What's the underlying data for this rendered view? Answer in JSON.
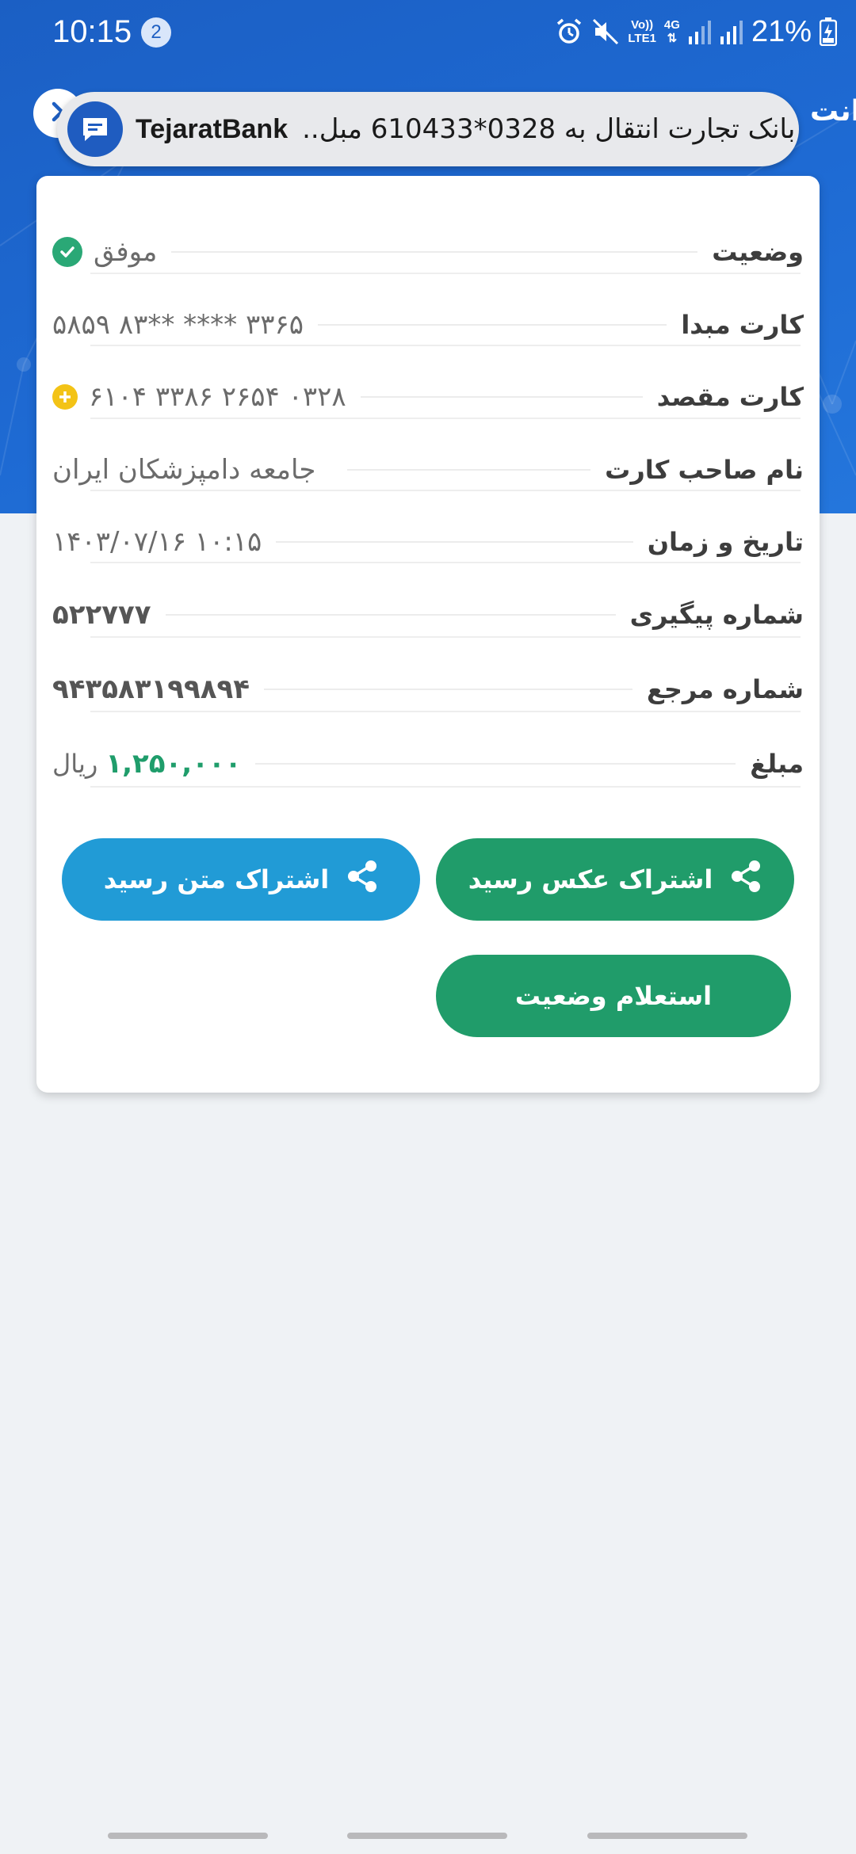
{
  "status_bar": {
    "time": "10:15",
    "notification_count": "2",
    "network_volte": "Vo))",
    "network_lte": "LTE1",
    "network_type": "4G",
    "battery": "21%"
  },
  "header": {
    "title_peek": "انت"
  },
  "notification": {
    "app_name": "TejaratBank",
    "text": "بانک تجارت انتقال به 0328*610433 مبل.."
  },
  "receipt": {
    "rows": [
      {
        "label": "وضعیت",
        "value": "موفق"
      },
      {
        "label": "کارت مبدا",
        "value": "۵۸۵۹  ۸۳**  ****  ۳۳۶۵"
      },
      {
        "label": "کارت مقصد",
        "value": "۶۱۰۴  ۳۳۸۶  ۲۶۵۴  ۰۳۲۸"
      },
      {
        "label": "نام صاحب کارت",
        "value": "جامعه دامپزشکان ایران"
      },
      {
        "label": "تاریخ و زمان",
        "value": "۱۴۰۳/۰۷/۱۶  ۱۰:۱۵"
      },
      {
        "label": "شماره پیگیری",
        "value": "۵۲۲۷۷۷"
      },
      {
        "label": "شماره مرجع",
        "value": "۹۴۳۵۸۳۱۹۹۸۹۴"
      },
      {
        "label": "مبلغ",
        "value": "۱,۲۵۰,۰۰۰",
        "unit": "ریال"
      }
    ]
  },
  "buttons": {
    "share_image": "اشتراک عکس رسید",
    "share_text": "اشتراک متن رسید",
    "inquiry": "استعلام وضعیت"
  },
  "colors": {
    "header_blue": "#1e65cf",
    "success_green": "#209c6a",
    "share_blue": "#219bd6",
    "add_yellow": "#f3c316"
  }
}
